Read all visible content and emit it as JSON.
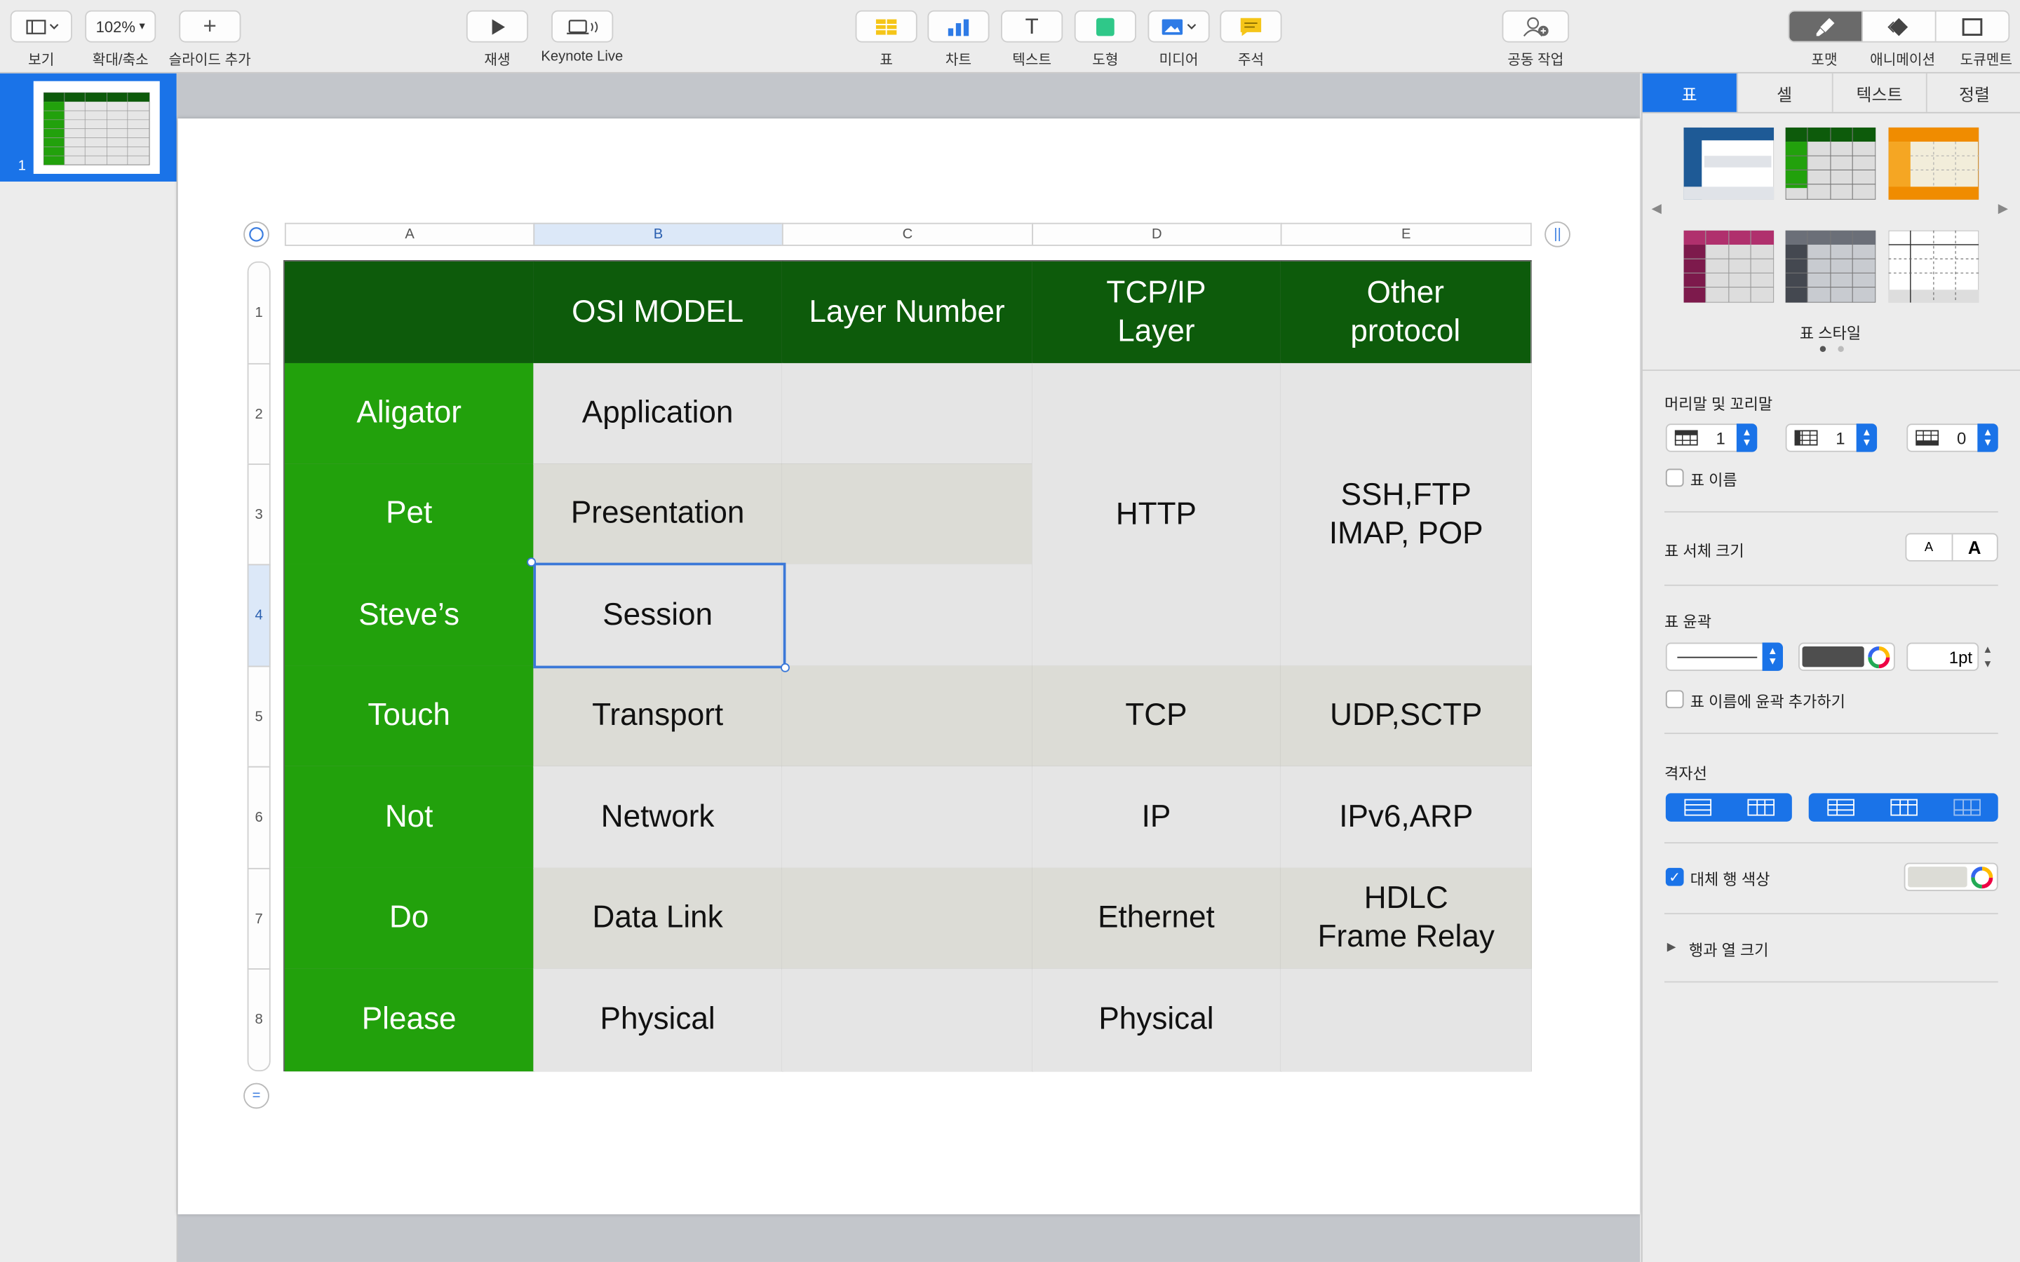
{
  "toolbar": {
    "view": "보기",
    "zoom_value": "102%",
    "zoom": "확대/축소",
    "add_slide": "슬라이드 추가",
    "play": "재생",
    "keynote_live": "Keynote Live",
    "table": "표",
    "chart": "차트",
    "text": "텍스트",
    "shape": "도형",
    "media": "미디어",
    "comment": "주석",
    "collaborate": "공동 작업",
    "format": "포맷",
    "animate": "애니메이션",
    "document": "도큐멘트"
  },
  "sidebar": {
    "slide_number": "1"
  },
  "table": {
    "columns": [
      "A",
      "B",
      "C",
      "D",
      "E"
    ],
    "rows": [
      "1",
      "2",
      "3",
      "4",
      "5",
      "6",
      "7",
      "8"
    ],
    "header": [
      "",
      "OSI MODEL",
      "Layer Number",
      "TCP/IP\nLayer",
      "Other\nprotocol"
    ],
    "row_labels": [
      "Aligator",
      "Pet",
      "Steve’s",
      "Touch",
      "Not",
      "Do",
      "Please"
    ],
    "osi": [
      "Application",
      "Presentation",
      "Session",
      "Transport",
      "Network",
      "Data Link",
      "Physical"
    ],
    "tcpip": {
      "http": "HTTP",
      "tcp": "TCP",
      "ip": "IP",
      "ethernet": "Ethernet",
      "physical": "Physical"
    },
    "other": {
      "ssh": "SSH,FTP\nIMAP, POP",
      "udp": "UDP,SCTP",
      "ipv6": "IPv6,ARP",
      "hdlc": "HDLC\nFrame Relay"
    }
  },
  "inspector": {
    "tabs": [
      "표",
      "셀",
      "텍스트",
      "정렬"
    ],
    "table_styles_label": "표 스타일",
    "headers_footers": "머리말 및 꼬리말",
    "header_rows": "1",
    "header_cols": "1",
    "footer_rows": "0",
    "table_name": "표 이름",
    "font_size": "표 서체 크기",
    "font_small": "A",
    "font_large": "A",
    "outline": "표 윤곽",
    "outline_width": "1pt",
    "outline_table_name": "표 이름에 윤곽 추가하기",
    "gridlines": "격자선",
    "alt_row_color": "대체 행 색상",
    "row_col_size": "행과 열 크기"
  },
  "colors": {
    "header_green": "#0d5b0b",
    "row_green": "#22a10c",
    "accent": "#1a73e8"
  }
}
